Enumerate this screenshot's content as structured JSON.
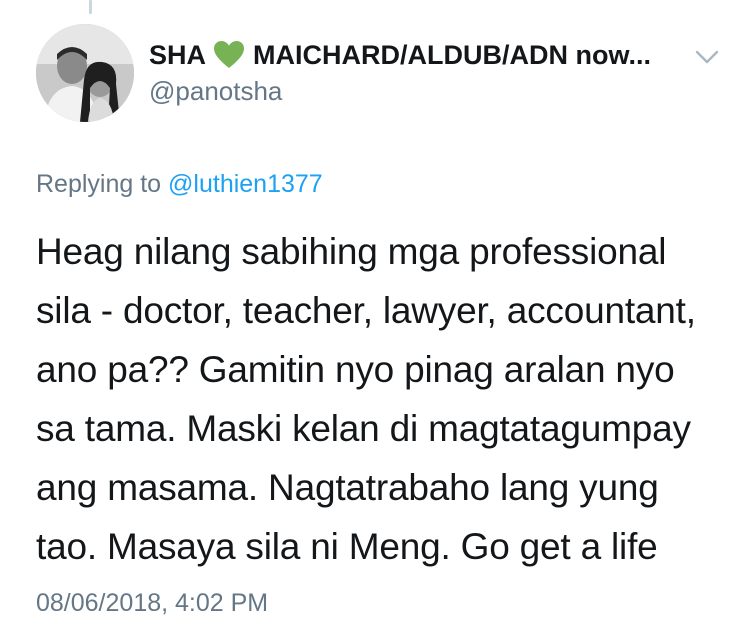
{
  "tweet": {
    "display_name": "SHA",
    "badge_icon": "green-heart-icon",
    "badge_color": "#77b255",
    "display_name_rest": "MAICHARD/ALDUB/ADN now...",
    "handle": "@panotsha",
    "menu_icon": "chevron-down-icon",
    "replying_prefix": "Replying to",
    "replying_to": "@luthien1377",
    "text_lines": [
      "Heag nilang sabihing mga professional",
      "sila - doctor, teacher, lawyer, accountant,",
      "ano pa?? Gamitin nyo pinag aralan nyo",
      "sa tama. Maski kelan di magtatagumpay",
      "ang masama. Nagtatrabaho lang yung",
      "tao. Masaya sila ni Meng. Go get a life"
    ],
    "timestamp": "08/06/2018, 4:02 PM"
  },
  "colors": {
    "secondary_text": "#657786",
    "link": "#1da1f2",
    "primary_text": "#14171a"
  }
}
